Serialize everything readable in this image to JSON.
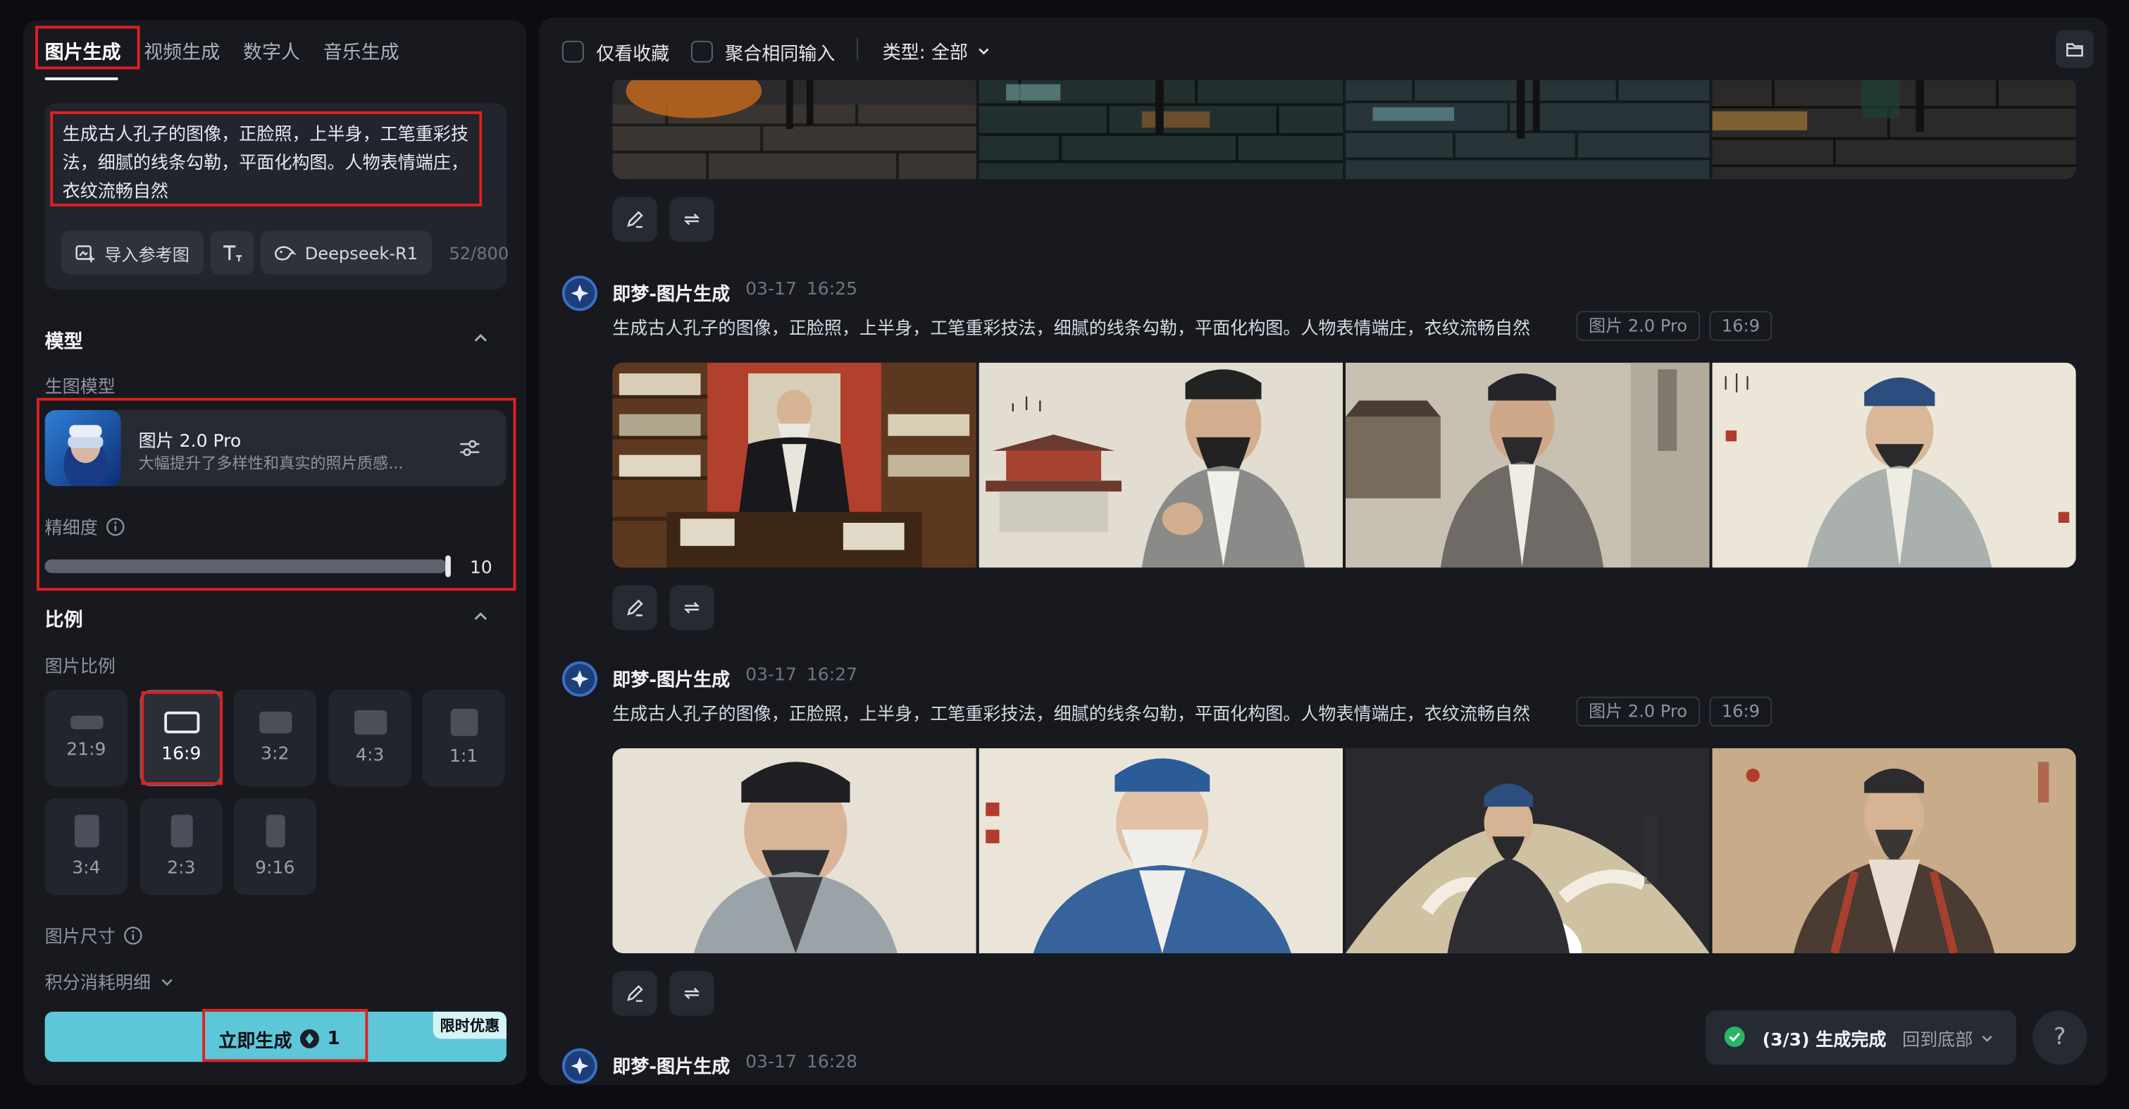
{
  "tabs": [
    "图片生成",
    "视频生成",
    "数字人",
    "音乐生成"
  ],
  "prompt": {
    "text": "生成古人孔子的图像，正脸照，上半身，工笔重彩技法，细腻的线条勾勒，平面化构图。人物表情端庄，衣纹流畅自然",
    "import_ref_label": "导入参考图",
    "model_chip_label": "Deepseek-R1",
    "char_count": "52/800"
  },
  "model_section": {
    "title": "模型",
    "gen_model_label": "生图模型",
    "model_name": "图片 2.0 Pro",
    "model_desc": "大幅提升了多样性和真实的照片质感...",
    "detail_label": "精细度",
    "detail_value": "10",
    "detail_fraction": 1.0
  },
  "ratio_section": {
    "title": "比例",
    "ratio_label": "图片比例",
    "ratios": [
      "21:9",
      "16:9",
      "3:2",
      "4:3",
      "1:1",
      "3:4",
      "2:3",
      "9:16"
    ],
    "selected": "16:9",
    "size_label": "图片尺寸",
    "points_label": "积分消耗明细"
  },
  "generate": {
    "label": "立即生成",
    "cost": "1",
    "promo": "限时优惠"
  },
  "toolbar": {
    "favorites_label": "仅看收藏",
    "merge_label": "聚合相同输入",
    "type_label": "类型: 全部"
  },
  "feed": [
    {
      "name": "即梦-图片生成",
      "date": "03-17",
      "time": "16:25",
      "prompt": "生成古人孔子的图像，正脸照，上半身，工笔重彩技法，细腻的线条勾勒，平面化构图。人物表情端庄，衣纹流畅自然",
      "model": "图片 2.0 Pro",
      "ratio": "16:9"
    },
    {
      "name": "即梦-图片生成",
      "date": "03-17",
      "time": "16:27",
      "prompt": "生成古人孔子的图像，正脸照，上半身，工笔重彩技法，细腻的线条勾勒，平面化构图。人物表情端庄，衣纹流畅自然",
      "model": "图片 2.0 Pro",
      "ratio": "16:9"
    },
    {
      "name": "即梦-图片生成",
      "date": "03-17",
      "time": "16:28"
    }
  ],
  "status": {
    "text": "(3/3) 生成完成",
    "back_label": "回到底部"
  },
  "help_label": "?",
  "colors": {
    "accent": "#5ec6d9",
    "panel": "#17191f",
    "highlight": "#e02020"
  }
}
